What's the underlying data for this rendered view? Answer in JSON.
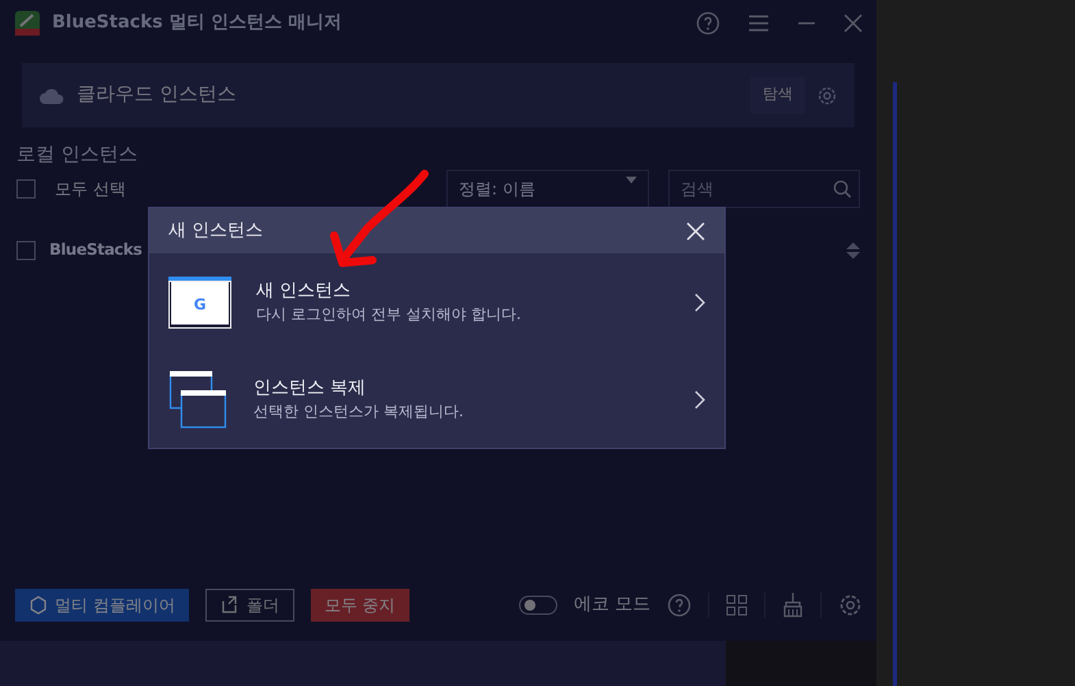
{
  "window": {
    "title": "BlueStacks 멀티 인스턴스 매니저"
  },
  "cloud_bar": {
    "label": "클라우드 인스턴스",
    "button": "탐색"
  },
  "local": {
    "heading": "로컬 인스턴스",
    "select_all": {
      "label": "모두 선택",
      "checked": false
    },
    "sort": "정렬: 이름",
    "search": {
      "placeholder": "검색"
    }
  },
  "instances": [
    {
      "name": "BlueStacks",
      "checked": false
    }
  ],
  "footer": {
    "buttons": [
      {
        "kind": "primary",
        "label": "멀티 컴플레이어"
      },
      {
        "kind": "outline",
        "label": "폴더"
      },
      {
        "kind": "danger",
        "label": "모두 중지"
      }
    ],
    "eco_mode": {
      "label": "에코 모드",
      "on": false
    }
  },
  "dialog": {
    "title": "새 인스턴스",
    "options": [
      {
        "kind": "new",
        "logo_letter": "G",
        "title": "새 인스턴스",
        "subtitle": "다시 로그인하여 전부 설치해야 합니다."
      },
      {
        "kind": "clone",
        "title": "인스턴스 복제",
        "subtitle": "선택한 인스턴스가 복제됩니다."
      }
    ]
  }
}
